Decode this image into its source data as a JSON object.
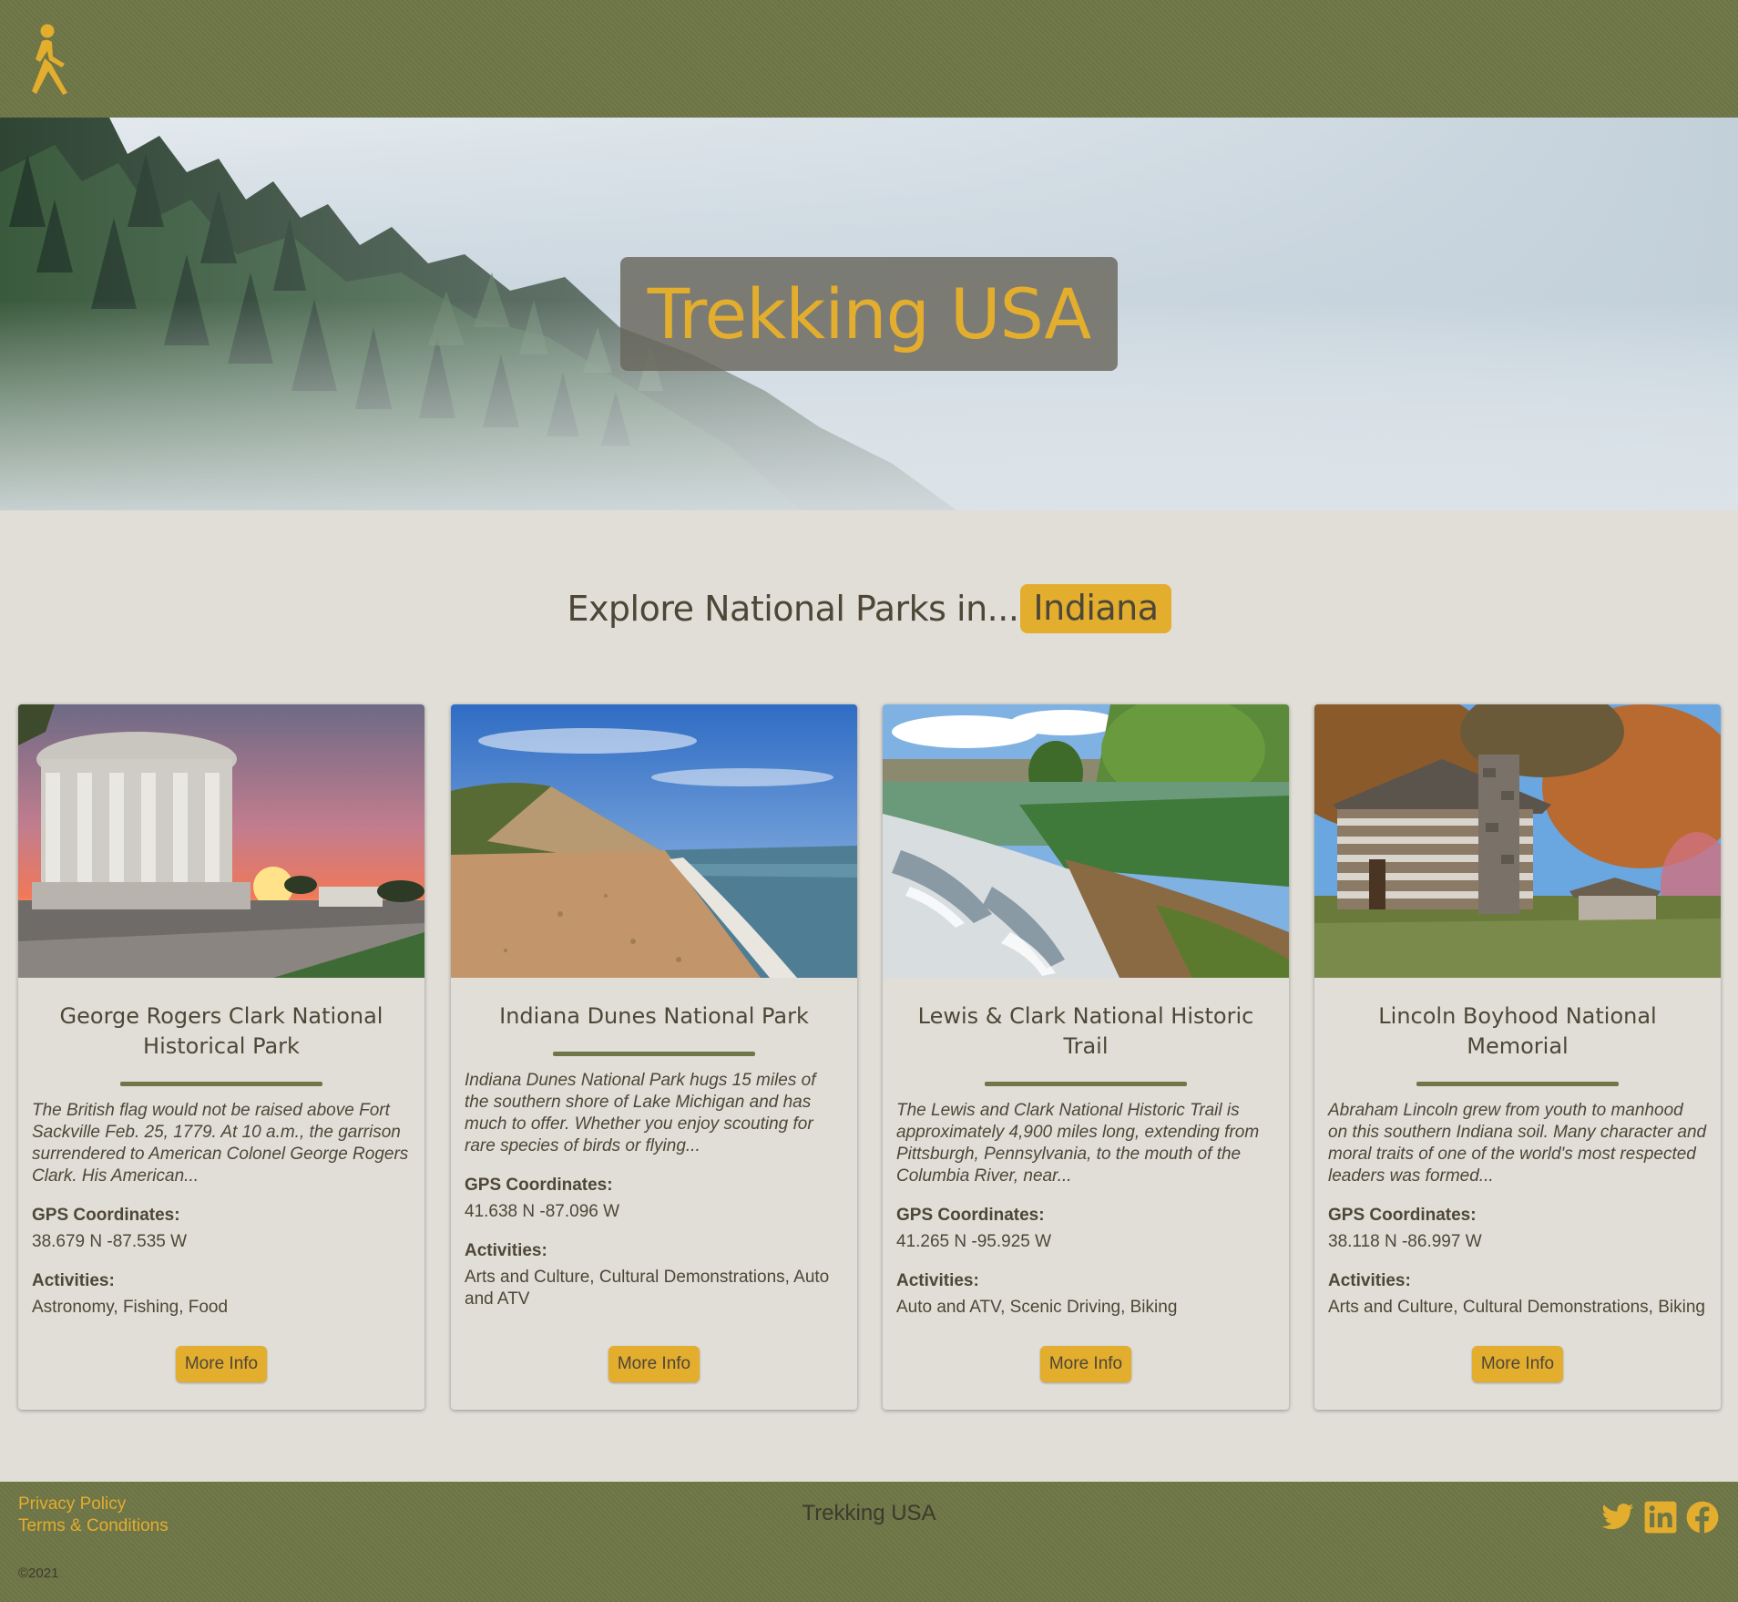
{
  "header": {
    "logo_icon": "walking-person-icon"
  },
  "hero": {
    "title": "Trekking USA"
  },
  "explore": {
    "prefix": "Explore National Parks in...",
    "state": "Indiana"
  },
  "labels": {
    "gps": "GPS Coordinates:",
    "activities": "Activities:",
    "more_info": "More Info"
  },
  "parks": [
    {
      "name": "George Rogers Clark National Historical Park",
      "description": "The British flag would not be raised above Fort Sackville Feb. 25, 1779. At 10 a.m., the garrison surrendered to American Colonel George Rogers Clark. His American...",
      "gps": "38.679 N -87.535 W",
      "activities": "Astronomy, Fishing, Food"
    },
    {
      "name": "Indiana Dunes National Park",
      "description": "Indiana Dunes National Park hugs 15 miles of the southern shore of Lake Michigan and has much to offer. Whether you enjoy scouting for rare species of birds or flying...",
      "gps": "41.638 N -87.096 W",
      "activities": "Arts and Culture, Cultural Demonstrations, Auto and ATV"
    },
    {
      "name": "Lewis & Clark National Historic Trail",
      "description": "The Lewis and Clark National Historic Trail is approximately 4,900 miles long, extending from Pittsburgh, Pennsylvania, to the mouth of the Columbia River, near...",
      "gps": "41.265 N -95.925 W",
      "activities": "Auto and ATV, Scenic Driving, Biking"
    },
    {
      "name": "Lincoln Boyhood National Memorial",
      "description": "Abraham Lincoln grew from youth to manhood on this southern Indiana soil. Many character and moral traits of one of the world's most respected leaders was formed...",
      "gps": "38.118 N -86.997 W",
      "activities": "Arts and Culture, Cultural Demonstrations, Biking"
    }
  ],
  "footer": {
    "privacy": "Privacy Policy",
    "terms": "Terms & Conditions",
    "title": "Trekking USA",
    "copyright": "©2021",
    "social_icons": [
      "twitter-icon",
      "linkedin-icon",
      "facebook-icon"
    ]
  },
  "colors": {
    "olive": "#6f7647",
    "gold": "#e3ad2e",
    "background": "#e1ded8",
    "text": "#4d4737"
  }
}
